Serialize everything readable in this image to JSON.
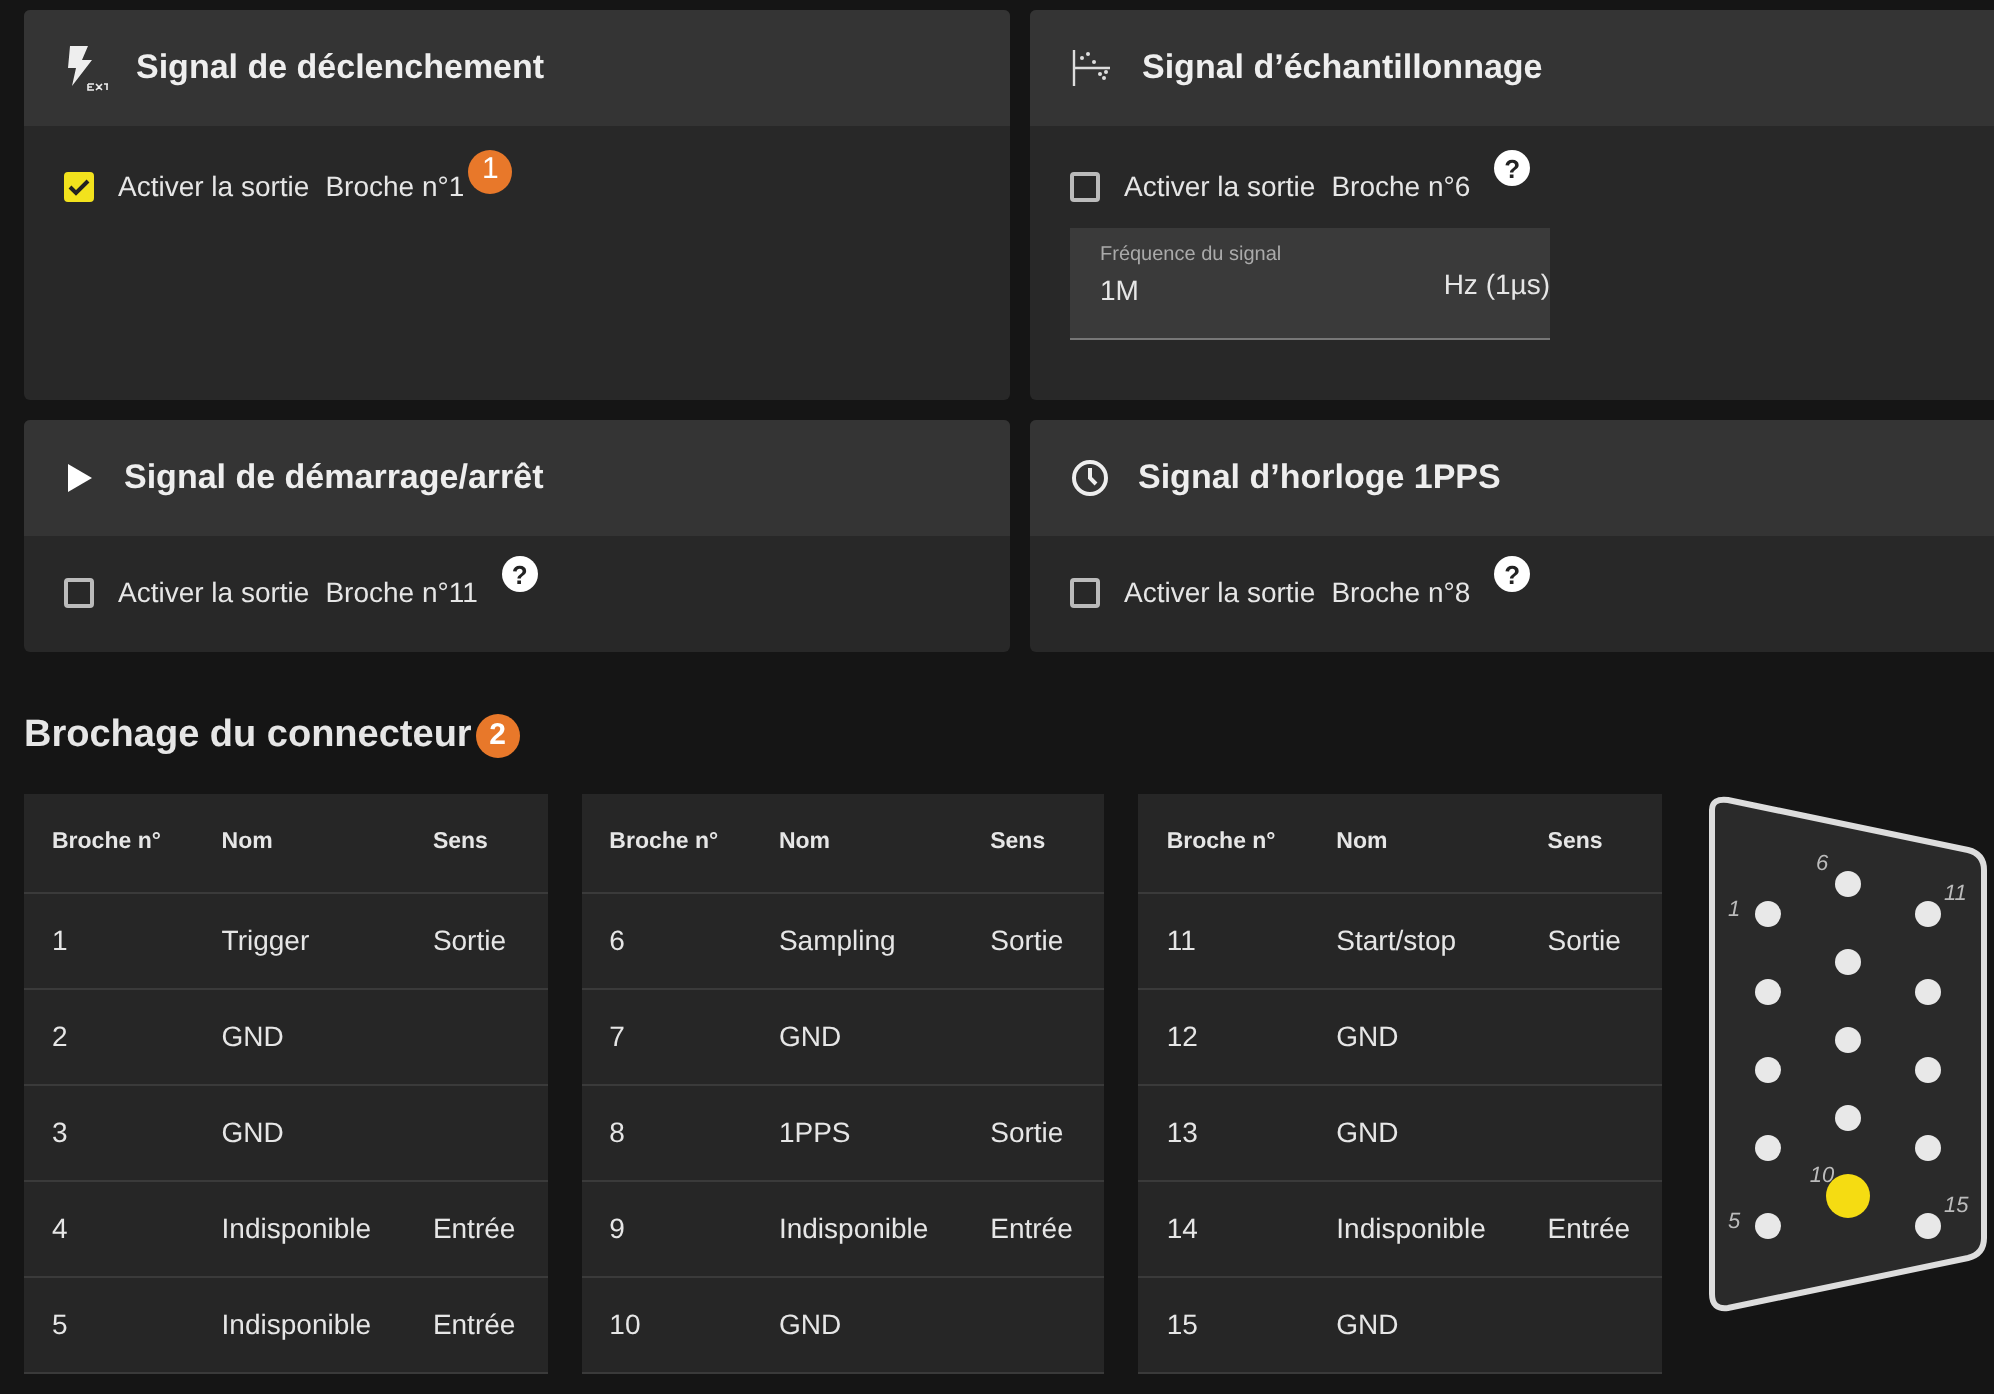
{
  "signals": [
    {
      "kind": "trigger",
      "title": "Signal de déclenchement",
      "checked": true,
      "label": "Activer la sortie",
      "pin": "Broche n°1",
      "callout": "1"
    },
    {
      "kind": "sampling",
      "title": "Signal d’échantillonnage",
      "checked": false,
      "label": "Activer la sortie",
      "pin": "Broche n°6",
      "help": "?",
      "field": {
        "label": "Fréquence du signal",
        "value": "1M",
        "unit": "Hz (1µs)"
      }
    },
    {
      "kind": "startstop",
      "title": "Signal de démarrage/arrêt",
      "checked": false,
      "label": "Activer la sortie",
      "pin": "Broche n°11",
      "help": "?"
    },
    {
      "kind": "clock",
      "title": "Signal d’horloge 1PPS",
      "checked": false,
      "label": "Activer la sortie",
      "pin": "Broche n°8",
      "help": "?"
    }
  ],
  "pinout": {
    "title": "Brochage du connecteur",
    "callout": "2",
    "tables": [
      {
        "columns": [
          "Broche n°",
          "Nom",
          "Sens"
        ],
        "rows": [
          [
            "1",
            "Trigger",
            "Sortie"
          ],
          [
            "2",
            "GND",
            ""
          ],
          [
            "3",
            "GND",
            ""
          ],
          [
            "4",
            "Indisponible",
            "Entrée"
          ],
          [
            "5",
            "Indisponible",
            "Entrée"
          ]
        ]
      },
      {
        "columns": [
          "Broche n°",
          "Nom",
          "Sens"
        ],
        "rows": [
          [
            "6",
            "Sampling",
            "Sortie"
          ],
          [
            "7",
            "GND",
            ""
          ],
          [
            "8",
            "1PPS",
            "Sortie"
          ],
          [
            "9",
            "Indisponible",
            "Entrée"
          ],
          [
            "10",
            "GND",
            ""
          ]
        ]
      },
      {
        "columns": [
          "Broche n°",
          "Nom",
          "Sens"
        ],
        "rows": [
          [
            "11",
            "Start/stop",
            "Sortie"
          ],
          [
            "12",
            "GND",
            ""
          ],
          [
            "13",
            "GND",
            ""
          ],
          [
            "14",
            "Indisponible",
            "Entrée"
          ],
          [
            "15",
            "GND",
            ""
          ]
        ]
      }
    ],
    "connector": {
      "pins": [
        {
          "label": "1",
          "highlighted": false
        },
        {
          "highlighted": false
        },
        {
          "highlighted": false
        },
        {
          "highlighted": false
        },
        {
          "label": "5",
          "highlighted": false
        },
        {
          "label": "6",
          "highlighted": false
        },
        {
          "highlighted": false
        },
        {
          "highlighted": false
        },
        {
          "highlighted": false
        },
        {
          "label": "10",
          "highlighted": true
        },
        {
          "label": "11",
          "highlighted": false
        },
        {
          "highlighted": false
        },
        {
          "highlighted": false
        },
        {
          "highlighted": false
        },
        {
          "label": "15",
          "highlighted": false
        }
      ]
    }
  }
}
